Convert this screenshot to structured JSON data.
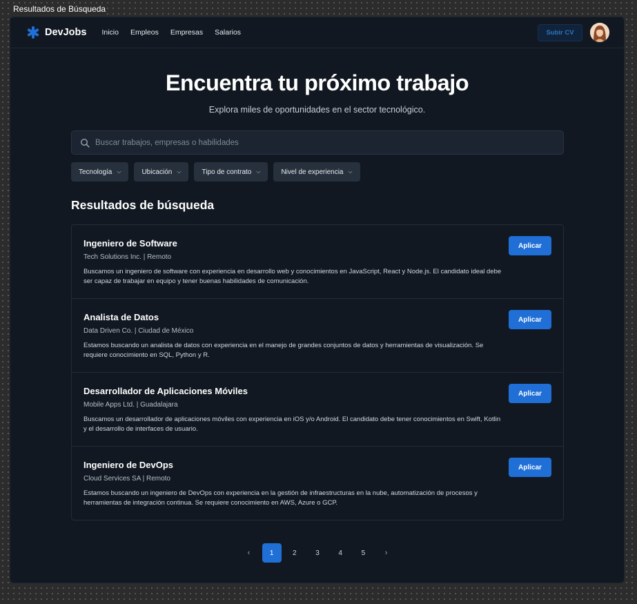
{
  "window": {
    "title": "Resultados de Búsqueda"
  },
  "header": {
    "brand": "DevJobs",
    "nav": [
      "Inicio",
      "Empleos",
      "Empresas",
      "Salarios"
    ],
    "upload_label": "Subir CV"
  },
  "hero": {
    "title": "Encuentra tu próximo trabajo",
    "subtitle": "Explora miles de oportunidades en el sector tecnológico."
  },
  "search": {
    "placeholder": "Buscar trabajos, empresas o habilidades",
    "value": ""
  },
  "filters": [
    "Tecnología",
    "Ubicación",
    "Tipo de contrato",
    "Nivel de experiencia"
  ],
  "results": {
    "title": "Resultados de búsqueda",
    "apply_label": "Aplicar",
    "jobs": [
      {
        "title": "Ingeniero de Software",
        "meta": "Tech Solutions Inc. | Remoto",
        "description": "Buscamos un ingeniero de software con experiencia en desarrollo web y conocimientos en JavaScript, React y Node.js. El candidato ideal debe ser capaz de trabajar en equipo y tener buenas habilidades de comunicación."
      },
      {
        "title": "Analista de Datos",
        "meta": "Data Driven Co. | Ciudad de México",
        "description": "Estamos buscando un analista de datos con experiencia en el manejo de grandes conjuntos de datos y herramientas de visualización. Se requiere conocimiento en SQL, Python y R."
      },
      {
        "title": "Desarrollador de Aplicaciones Móviles",
        "meta": "Mobile Apps Ltd. | Guadalajara",
        "description": "Buscamos un desarrollador de aplicaciones móviles con experiencia en iOS y/o Android. El candidato debe tener conocimientos en Swift, Kotlin y el desarrollo de interfaces de usuario."
      },
      {
        "title": "Ingeniero de DevOps",
        "meta": "Cloud Services SA | Remoto",
        "description": "Estamos buscando un ingeniero de DevOps con experiencia en la gestión de infraestructuras en la nube, automatización de procesos y herramientas de integración continua. Se requiere conocimiento en AWS, Azure o GCP."
      }
    ]
  },
  "pagination": {
    "prev_icon": "chevron-left-icon",
    "next_icon": "chevron-right-icon",
    "pages": [
      "1",
      "2",
      "3",
      "4",
      "5"
    ],
    "current": "1"
  },
  "colors": {
    "accent": "#1f6fd6",
    "background": "#111821",
    "surface": "#27313d"
  }
}
